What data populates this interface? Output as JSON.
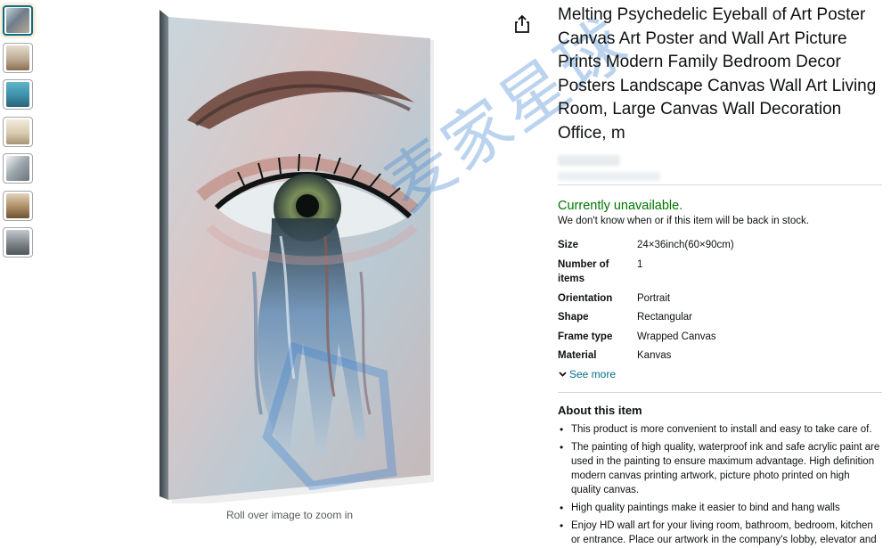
{
  "gallery": {
    "thumbnails": [
      {
        "name": "thumb-eye-canvas",
        "color": "#8a9aa8"
      },
      {
        "name": "thumb-room-1",
        "color": "#b8a58e"
      },
      {
        "name": "thumb-room-2",
        "color": "#3c8fa8"
      },
      {
        "name": "thumb-room-3",
        "color": "#d8cbb0"
      },
      {
        "name": "thumb-canvas-side",
        "color": "#9aa4ab"
      },
      {
        "name": "thumb-room-4",
        "color": "#a7865e"
      },
      {
        "name": "thumb-room-5",
        "color": "#777f86"
      }
    ],
    "zoom_hint": "Roll over image to zoom in"
  },
  "product": {
    "title": "Melting Psychedelic Eyeball of Art Poster Canvas Art Poster and Wall Art Picture Prints Modern Family Bedroom Decor Posters Landscape Canvas Wall Art Living Room, Large Canvas Wall Decoration Office, m",
    "availability": "Currently unavailable.",
    "restock_note": "We don't know when or if this item will be back in stock.",
    "specs": [
      {
        "key": "Size",
        "value": "24×36inch(60×90cm)"
      },
      {
        "key": "Number of items",
        "value": "1"
      },
      {
        "key": "Orientation",
        "value": "Portrait"
      },
      {
        "key": "Shape",
        "value": "Rectangular"
      },
      {
        "key": "Frame type",
        "value": "Wrapped Canvas"
      },
      {
        "key": "Material",
        "value": "Kanvas"
      }
    ],
    "see_more": "See more",
    "about_title": "About this item",
    "bullets": [
      "This product is more convenient to install and easy to take care of.",
      "The painting of high quality, waterproof ink and safe acrylic paint are used in the painting to ensure maximum advantage. High definition modern canvas printing artwork, picture photo printed on high quality canvas.",
      "High quality paintings make it easier to bind and hang walls",
      "Enjoy HD wall art for your living room, bathroom, bedroom, kitchen or entrance. Place our artwork in the company's lobby, elevator and"
    ]
  },
  "watermark": "麦家星球",
  "colors": {
    "availability": "#007600",
    "link": "#007185",
    "active_thumb_border": "#007185"
  }
}
